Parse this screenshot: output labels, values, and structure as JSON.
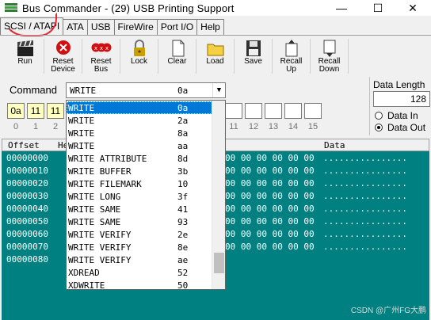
{
  "window": {
    "title": "Bus Commander - (29) USB Printing Support",
    "controls": {
      "minimize": "—",
      "maximize": "☐",
      "close": "✕"
    }
  },
  "menu": {
    "tabs": [
      {
        "label": "SCSI / ATAPI",
        "active": true
      },
      {
        "label": "ATA"
      },
      {
        "label": "USB"
      },
      {
        "label": "FireWire"
      },
      {
        "label": "Port I/O"
      },
      {
        "label": "Help"
      }
    ]
  },
  "toolbar": {
    "run": "Run",
    "reset_device_1": "Reset",
    "reset_device_2": "Device",
    "reset_bus_1": "Reset",
    "reset_bus_2": "Bus",
    "lock": "Lock",
    "clear": "Clear",
    "load": "Load",
    "save": "Save",
    "recall_up_1": "Recall",
    "recall_up_2": "Up",
    "recall_down_1": "Recall",
    "recall_down_2": "Down"
  },
  "command": {
    "label": "Command",
    "selected_name": "WRITE",
    "selected_code": "0a"
  },
  "cdb": {
    "values": [
      "0a",
      "11",
      "11"
    ],
    "indices": [
      "0",
      "1",
      "2",
      "11",
      "12",
      "13",
      "14",
      "15"
    ]
  },
  "data_length": {
    "label": "Data Length",
    "value": "128",
    "data_in": "Data In",
    "data_out": "Data Out",
    "selected": "Data Out"
  },
  "grid": {
    "headers": {
      "offset": "Offset",
      "hex": "He",
      "data": "Data"
    },
    "offsets": [
      "00000000",
      "00000010",
      "00000020",
      "00000030",
      "00000040",
      "00000050",
      "00000060",
      "00000070",
      "00000080"
    ],
    "hex_tail": "00 00 00 00 00 00",
    "ascii": "................"
  },
  "dropdown": {
    "items": [
      {
        "name": "WRITE",
        "code": "0a"
      },
      {
        "name": "WRITE",
        "code": "2a"
      },
      {
        "name": "WRITE",
        "code": "8a"
      },
      {
        "name": "WRITE",
        "code": "aa"
      },
      {
        "name": "WRITE ATTRIBUTE",
        "code": "8d"
      },
      {
        "name": "WRITE BUFFER",
        "code": "3b"
      },
      {
        "name": "WRITE FILEMARK",
        "code": "10"
      },
      {
        "name": "WRITE LONG",
        "code": "3f"
      },
      {
        "name": "WRITE SAME",
        "code": "41"
      },
      {
        "name": "WRITE SAME",
        "code": "93"
      },
      {
        "name": "WRITE VERIFY",
        "code": "2e"
      },
      {
        "name": "WRITE VERIFY",
        "code": "8e"
      },
      {
        "name": "WRITE VERIFY",
        "code": "ae"
      },
      {
        "name": "XDREAD",
        "code": "52"
      },
      {
        "name": "XDWRITE",
        "code": "50"
      }
    ]
  },
  "watermark": "CSDN @广州FG大鹏",
  "colors": {
    "grid_bg": "#008080",
    "selection": "#0078d7",
    "cdb_filled": "#ffffc0",
    "annotation": "#e8262d"
  }
}
